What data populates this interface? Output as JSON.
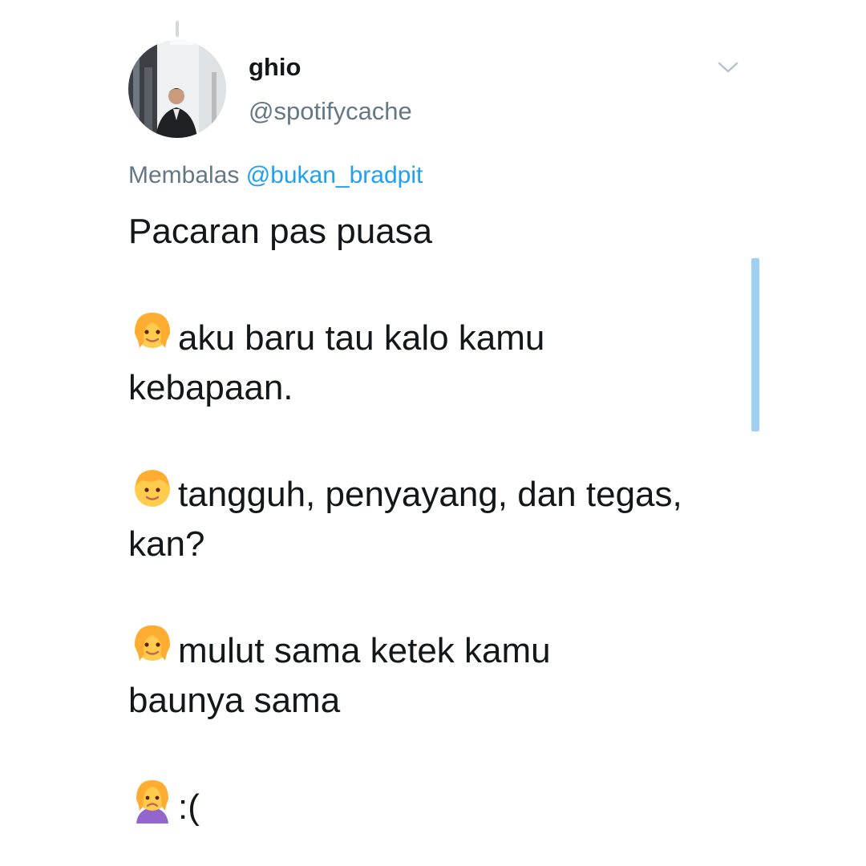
{
  "tweet": {
    "author_name": "ghio",
    "author_handle": "@spotifycache",
    "reply_prefix": "Membalas",
    "reply_handle": "@bukan_bradpit",
    "lines": {
      "l1": "Pacaran pas puasa",
      "l2": "aku baru tau kalo kamu",
      "l3": "kebapaan.",
      "l4": "tangguh, penyayang, dan tegas,",
      "l5": "kan?",
      "l6": "mulut sama ketek kamu",
      "l7": "baunya sama",
      "l8": ":("
    }
  },
  "icons": {
    "menu": "chevron-down-icon",
    "emoji_1": "woman-emoji",
    "emoji_2": "man-emoji",
    "emoji_3": "woman-emoji",
    "emoji_4": "woman-frowning-emoji"
  },
  "colors": {
    "link": "#1da1f2",
    "secondary_text": "#657786",
    "primary_text": "#14171a",
    "scrollbar": "#9fd0f3"
  }
}
